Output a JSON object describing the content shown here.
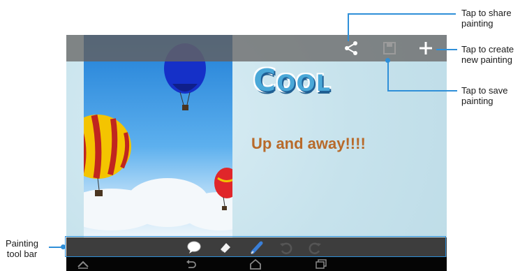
{
  "callouts": {
    "share": "Tap to share painting",
    "share_l1": "Tap to share",
    "share_l2": "painting",
    "new_l1": "Tap to create",
    "new_l2": "new painting",
    "save_l1": "Tap to save",
    "save_l2": "painting",
    "toolbar_l1": "Painting",
    "toolbar_l2": "tool bar"
  },
  "canvas": {
    "title_big": "C",
    "title_rest": "OOL",
    "headline": "Up and away!!!!"
  },
  "icons": {
    "top_bar": [
      "share-icon",
      "save-icon",
      "add-icon"
    ],
    "tool_bar": [
      "speech-bubble-icon",
      "eraser-icon",
      "pen-icon",
      "undo-icon",
      "redo-icon"
    ],
    "nav_bar": [
      "up-chevron-icon",
      "back-icon",
      "home-icon",
      "recent-apps-icon"
    ]
  },
  "colors": {
    "accent": "#2f8fd8",
    "headline": "#b86a2a",
    "title": "#4aa8d8"
  }
}
